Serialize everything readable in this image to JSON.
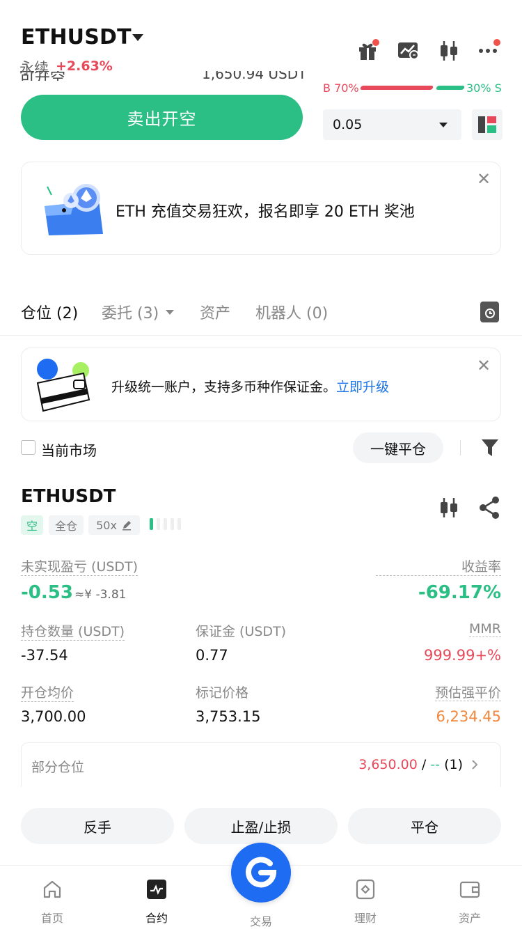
{
  "header": {
    "pair": "ETHUSDT",
    "type": "永续",
    "change": "+2.63%",
    "ghost_left": "可开空",
    "ghost_right": "1,650.94 USDT"
  },
  "order": {
    "sell_button": "卖出开空",
    "qty_value": "0.05",
    "buy_ratio_label": "B 70%",
    "sell_ratio_label": "30% S",
    "buy_ratio": 0.7,
    "sell_ratio": 0.3
  },
  "promo": {
    "text": "ETH 充值交易狂欢，报名即享 20 ETH 奖池",
    "close": "✕"
  },
  "tabs": {
    "positions": "仓位 (2)",
    "orders": "委托 (3)",
    "assets": "资产",
    "bots": "机器人 (0)"
  },
  "upgrade": {
    "text": "升级统一账户，支持多币种作保证金。",
    "link": "立即升级",
    "close": "✕"
  },
  "filter": {
    "current_market": "当前市场",
    "close_all": "一键平仓"
  },
  "position": {
    "symbol": "ETHUSDT",
    "side": "空",
    "margin_mode": "全仓",
    "leverage": "50x",
    "unrealized_label": "未实现盈亏 (USDT)",
    "unrealized_value": "-0.53",
    "unrealized_cny": "≈¥ -3.81",
    "roe_label": "收益率",
    "roe_value": "-69.17%",
    "size_label": "持仓数量 (USDT)",
    "size_value": "-37.54",
    "margin_label": "保证金 (USDT)",
    "margin_value": "0.77",
    "mmr_label": "MMR",
    "mmr_value": "999.99+%",
    "entry_label": "开仓均价",
    "entry_value": "3,700.00",
    "mark_label": "标记价格",
    "mark_value": "3,753.15",
    "liq_label": "预估强平价",
    "liq_value": "6,234.45",
    "partial_label": "部分仓位",
    "partial_price": "3,650.00",
    "partial_sep": "/",
    "partial_dash": "--",
    "partial_count": "(1)"
  },
  "actions": {
    "reverse": "反手",
    "tpsl": "止盈/止损",
    "close": "平仓"
  },
  "nav": {
    "home": "首页",
    "contract": "合约",
    "trade": "交易",
    "earn": "理财",
    "assets": "资产"
  },
  "colors": {
    "green": "#2cbf85",
    "red": "#e8495a",
    "orange": "#f0883e",
    "blue": "#1d6cf2",
    "link": "#1a73e8"
  }
}
